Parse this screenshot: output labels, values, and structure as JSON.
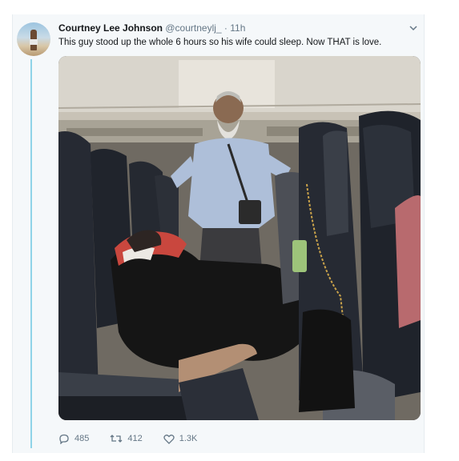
{
  "tweet": {
    "author_name": "Courtney Lee Johnson",
    "handle": "@courtneylj_",
    "separator": "·",
    "time": "11h",
    "text": "This guy stood up the whole 6 hours so his wife could sleep. Now THAT is love.",
    "menu_icon": "chevron-down-icon"
  },
  "actions": {
    "replies": "485",
    "retweets": "412",
    "likes": "1.3K",
    "icons": [
      "reply-icon",
      "retweet-icon",
      "like-icon"
    ]
  },
  "colors": {
    "accent_line": "#8fd3e8",
    "secondary_text": "#657786"
  }
}
